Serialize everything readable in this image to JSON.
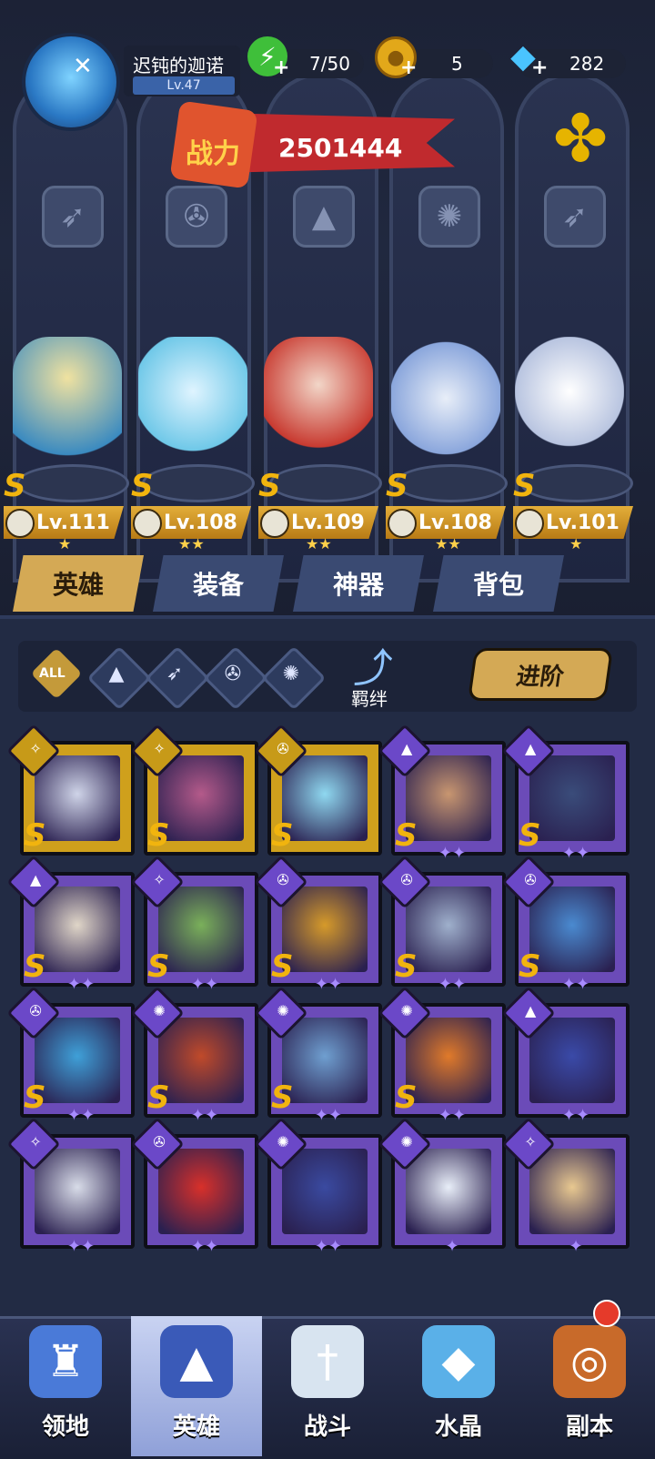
{
  "player": {
    "name": "迟钝的迦诺",
    "level": "Lv.47"
  },
  "resources": [
    {
      "icon": "energy-icon",
      "value": "7/50"
    },
    {
      "icon": "gold-coin-icon",
      "value": "5"
    },
    {
      "icon": "diamond-icon",
      "value": "282"
    }
  ],
  "power": {
    "label": "战力",
    "value": "2501444"
  },
  "team": [
    {
      "rank": "S",
      "level": "Lv.111",
      "class_icon": "wing-icon",
      "stars": "★",
      "color": "#e9d27a"
    },
    {
      "rank": "S",
      "level": "Lv.108",
      "class_icon": "wrench-icon",
      "stars": "★★",
      "color": "#8fd8f0"
    },
    {
      "rank": "S",
      "level": "Lv.109",
      "class_icon": "hat-icon",
      "stars": "★★",
      "color": "#d8483c"
    },
    {
      "rank": "S",
      "level": "Lv.108",
      "class_icon": "claw-icon",
      "stars": "★★",
      "color": "#b9c8ec"
    },
    {
      "rank": "S",
      "level": "Lv.101",
      "class_icon": "wing-icon",
      "stars": "★",
      "color": "#d6dcee"
    }
  ],
  "tabs": [
    "英雄",
    "装备",
    "神器",
    "背包"
  ],
  "filters": {
    "all": "ALL",
    "bond": "羁绊",
    "advance": "进阶"
  },
  "roster": [
    {
      "tier": "gold",
      "rank": "S",
      "stars": "",
      "face": "#cfd4e8"
    },
    {
      "tier": "gold",
      "rank": "S",
      "stars": "",
      "face": "#b45a8a"
    },
    {
      "tier": "gold",
      "rank": "S",
      "stars": "",
      "face": "#8fd8f0"
    },
    {
      "tier": "purple",
      "rank": "S",
      "stars": "✦✦",
      "face": "#c89670"
    },
    {
      "tier": "purple",
      "rank": "S",
      "stars": "✦✦",
      "face": "#3a4c7a"
    },
    {
      "tier": "purple",
      "rank": "S",
      "stars": "✦✦",
      "face": "#e0d6c8"
    },
    {
      "tier": "purple",
      "rank": "S",
      "stars": "✦✦",
      "face": "#7ab05a"
    },
    {
      "tier": "purple",
      "rank": "S",
      "stars": "✦✦",
      "face": "#d69a2a"
    },
    {
      "tier": "purple",
      "rank": "S",
      "stars": "✦✦",
      "face": "#9fb0cc"
    },
    {
      "tier": "purple",
      "rank": "S",
      "stars": "✦✦",
      "face": "#4a8ad0"
    },
    {
      "tier": "purple",
      "rank": "S",
      "stars": "✦✦",
      "face": "#3fa0d8"
    },
    {
      "tier": "purple",
      "rank": "S",
      "stars": "✦✦",
      "face": "#c04a2a"
    },
    {
      "tier": "purple",
      "rank": "S",
      "stars": "✦✦",
      "face": "#6f9fd0"
    },
    {
      "tier": "purple",
      "rank": "S",
      "stars": "✦✦",
      "face": "#e07a2a"
    },
    {
      "tier": "purple",
      "rank": "",
      "stars": "✦✦",
      "face": "#3a4aa8"
    },
    {
      "tier": "purple",
      "rank": "",
      "stars": "✦✦",
      "face": "#d8dce8"
    },
    {
      "tier": "purple",
      "rank": "",
      "stars": "✦✦",
      "face": "#d8302a"
    },
    {
      "tier": "purple",
      "rank": "",
      "stars": "✦✦",
      "face": "#3a4aa0"
    },
    {
      "tier": "purple",
      "rank": "",
      "stars": "✦",
      "face": "#e8eef8"
    },
    {
      "tier": "purple",
      "rank": "",
      "stars": "✦",
      "face": "#e8c890"
    }
  ],
  "nav": [
    {
      "label": "领地",
      "icon": "castle-icon",
      "active": false
    },
    {
      "label": "英雄",
      "icon": "wizard-hat-icon",
      "active": true
    },
    {
      "label": "战斗",
      "icon": "sword-icon",
      "active": false
    },
    {
      "label": "水晶",
      "icon": "crystal-icon",
      "active": false
    },
    {
      "label": "副本",
      "icon": "portal-icon",
      "active": false
    }
  ]
}
